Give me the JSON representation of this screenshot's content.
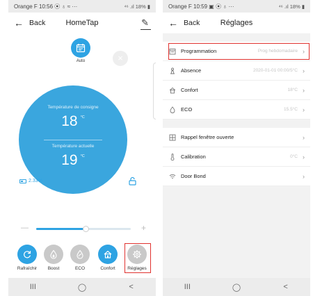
{
  "left": {
    "status": {
      "carrier_time": "Orange F 10:56",
      "icons": "⦿ ♁ ≈  ···",
      "right": "⁴⁶ .ıl 18% ▮"
    },
    "appbar": {
      "back_label": "Back",
      "title": "HomeTap"
    },
    "modes": {
      "auto_label": "Auto"
    },
    "dial": {
      "setpoint_label": "Température de consigne",
      "setpoint_value": "18",
      "setpoint_unit": "°C",
      "current_label": "Température actuelle",
      "current_value": "19",
      "current_unit": "°C"
    },
    "battery": {
      "value": "2.33%"
    },
    "slider": {
      "minus": "—",
      "plus": "+",
      "level": 0.52
    },
    "actions": [
      {
        "label": "Rafraîchir",
        "state": "on",
        "icon": "refresh-icon"
      },
      {
        "label": "Boost",
        "state": "off",
        "icon": "boost-icon"
      },
      {
        "label": "ECO",
        "state": "off",
        "icon": "eco-icon"
      },
      {
        "label": "Confort",
        "state": "on",
        "icon": "home-icon"
      },
      {
        "label": "Réglages",
        "state": "off",
        "icon": "gear-icon"
      }
    ],
    "nav": {
      "recent": "III",
      "home": "◯",
      "back": "<"
    }
  },
  "right": {
    "status": {
      "carrier_time": "Orange F 10:59",
      "icons": "▣ ⦿ ♁  ···",
      "right": "⁴⁶ .ıl 18% ▮"
    },
    "appbar": {
      "back_label": "Back",
      "title": "Réglages"
    },
    "group1": [
      {
        "label": "Programmation",
        "value": "Prog hebdomadaire",
        "icon": "calendar-icon"
      },
      {
        "label": "Absence",
        "value": "2020-01-01 00:00/5°C",
        "icon": "absence-icon"
      },
      {
        "label": "Confort",
        "value": "18°C",
        "icon": "home-icon"
      },
      {
        "label": "ECO",
        "value": "15.5°C",
        "icon": "eco-icon"
      }
    ],
    "group2": [
      {
        "label": "Rappel fenêtre ouverte",
        "value": "",
        "icon": "window-icon"
      },
      {
        "label": "Calibration",
        "value": "0°C",
        "icon": "thermometer-icon"
      },
      {
        "label": "Door Bond",
        "value": "",
        "icon": "wifi-icon"
      }
    ],
    "nav": {
      "recent": "III",
      "home": "◯",
      "back": "<"
    }
  },
  "colors": {
    "accent": "#2ea3e3",
    "highlight": "#e0322f",
    "inactive": "#c9c9c9"
  }
}
